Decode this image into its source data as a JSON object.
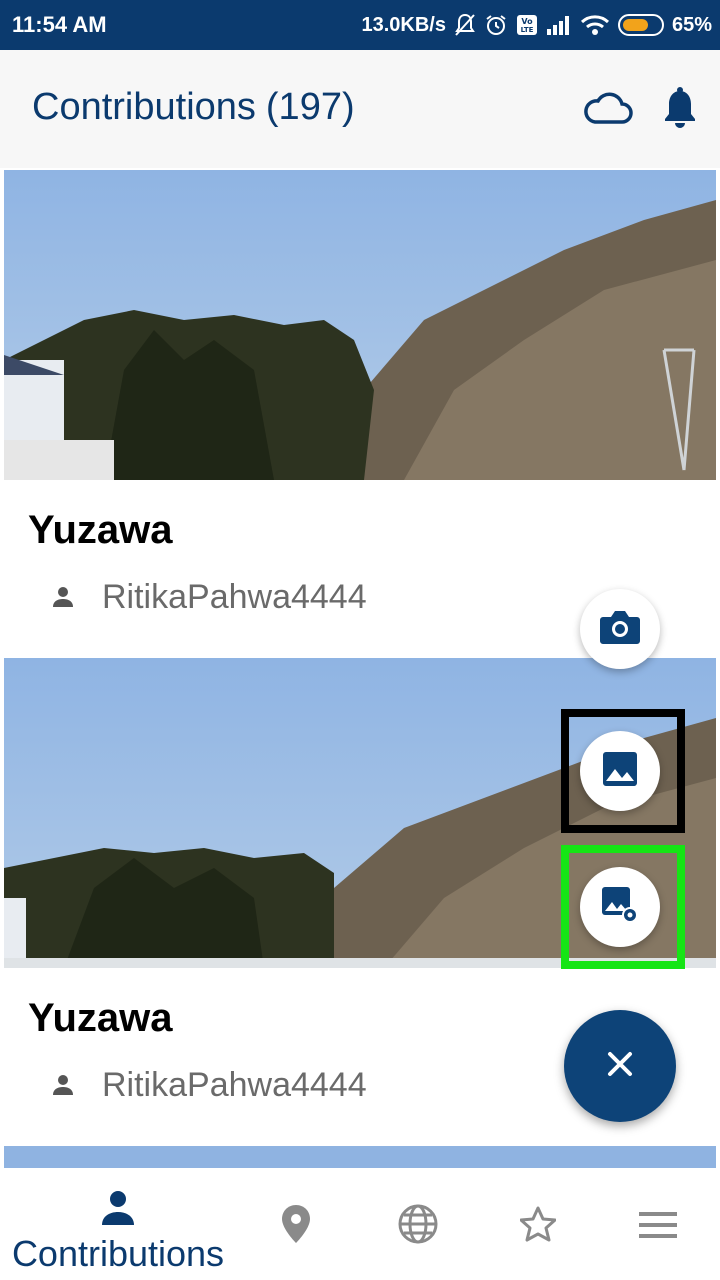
{
  "status_bar": {
    "time": "11:54 AM",
    "speed": "13.0KB/s",
    "battery": "65%",
    "battery_level": 0.65,
    "icons": [
      "mute-bell-icon",
      "alarm-icon",
      "volte-icon",
      "signal-icon",
      "wifi-icon",
      "battery-icon"
    ]
  },
  "app_bar": {
    "title": "Contributions",
    "count": "(197)",
    "icons": [
      "cloud-icon",
      "bell-icon"
    ]
  },
  "colors": {
    "primary": "#0b3a6e",
    "fab": "#0d4378",
    "highlight_black": "#000000",
    "highlight_green": "#15e515"
  },
  "contributions": [
    {
      "title": "Yuzawa",
      "author": "RitikaPahwa4444"
    },
    {
      "title": "Yuzawa",
      "author": "RitikaPahwa4444"
    }
  ],
  "fab_menu": {
    "actions": [
      "camera-icon",
      "image-icon",
      "custom-image-icon"
    ],
    "main_icon": "close-icon"
  },
  "bottom_nav": {
    "active_label": "Contributions",
    "items": [
      "person-icon",
      "location-pin-icon",
      "globe-icon",
      "star-icon",
      "menu-icon"
    ]
  }
}
